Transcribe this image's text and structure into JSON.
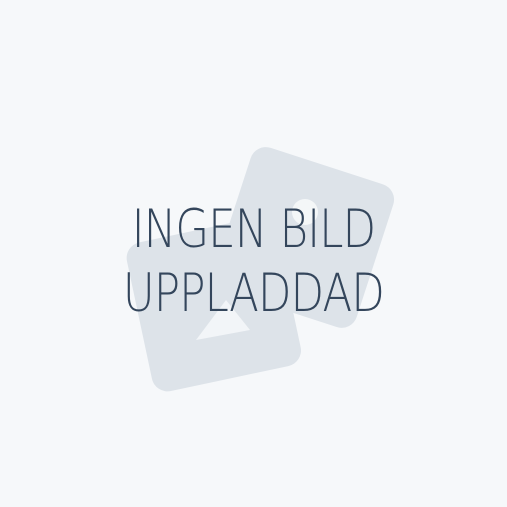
{
  "placeholder": {
    "line1": "INGEN BILD",
    "line2": "UPPLADDAD",
    "icon": "image-placeholder-icon",
    "colors": {
      "background": "#f6f8fa",
      "icon": "#dde3e9",
      "text": "#34465c"
    }
  }
}
